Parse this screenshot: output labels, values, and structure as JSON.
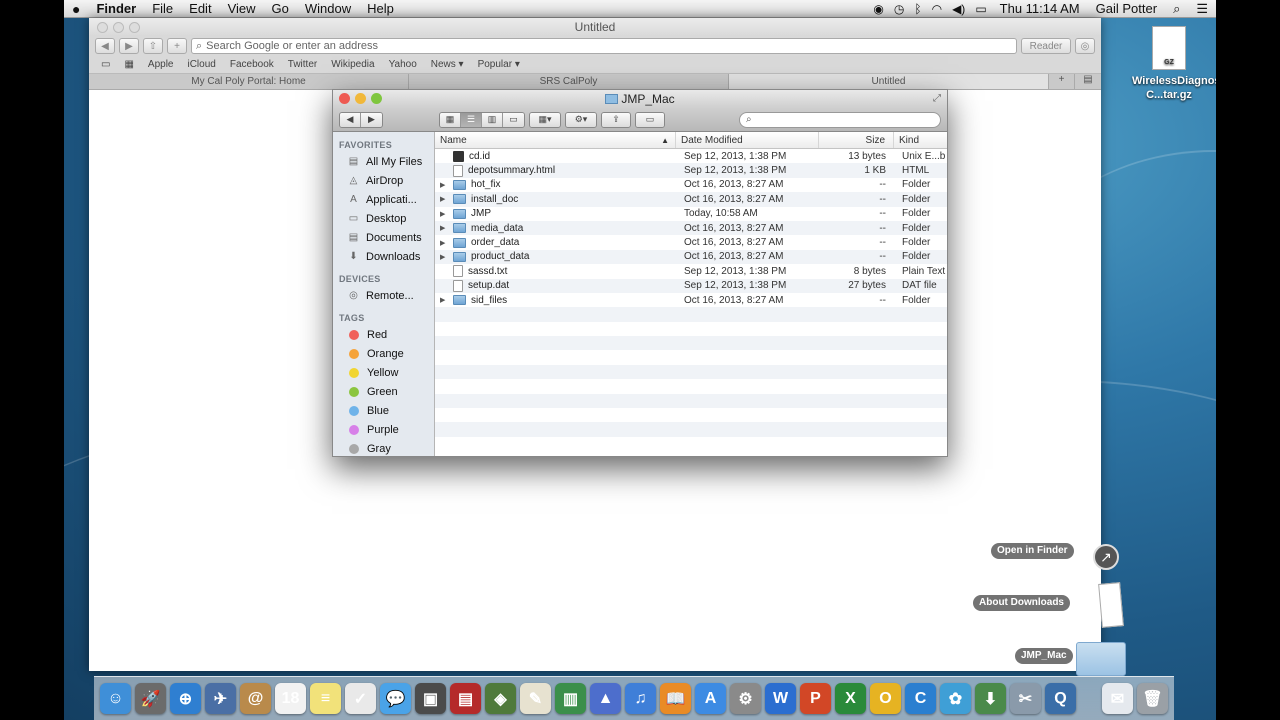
{
  "menubar": {
    "apple": "",
    "app_name": "Finder",
    "items": [
      "File",
      "Edit",
      "View",
      "Go",
      "Window",
      "Help"
    ],
    "clock": "Thu 11:14 AM",
    "user": "Gail Potter"
  },
  "safari": {
    "title": "Untitled",
    "address_placeholder": "Search Google or enter an address",
    "reader_label": "Reader",
    "bookmarks": [
      "Apple",
      "iCloud",
      "Facebook",
      "Twitter",
      "Wikipedia",
      "Yahoo",
      "News ▾",
      "Popular ▾"
    ],
    "tabs": [
      "My Cal Poly Portal: Home",
      "SRS CalPoly",
      "Untitled"
    ]
  },
  "finder": {
    "title": "JMP_Mac",
    "sidebar": {
      "favorites_label": "FAVORITES",
      "favorites": [
        "All My Files",
        "AirDrop",
        "Applicati...",
        "Desktop",
        "Documents",
        "Downloads"
      ],
      "devices_label": "DEVICES",
      "devices": [
        "Remote..."
      ],
      "tags_label": "TAGS",
      "tags": [
        {
          "name": "Red",
          "color": "#f0605a"
        },
        {
          "name": "Orange",
          "color": "#f5a33a"
        },
        {
          "name": "Yellow",
          "color": "#f1d531"
        },
        {
          "name": "Green",
          "color": "#8bc53f"
        },
        {
          "name": "Blue",
          "color": "#6fb3e9"
        },
        {
          "name": "Purple",
          "color": "#d780e8"
        },
        {
          "name": "Gray",
          "color": "#a8a8a8"
        }
      ]
    },
    "columns": {
      "name": "Name",
      "date": "Date Modified",
      "size": "Size",
      "kind": "Kind"
    },
    "files": [
      {
        "name": "cd.id",
        "date": "Sep 12, 2013, 1:38 PM",
        "size": "13 bytes",
        "kind": "Unix E...b",
        "type": "dark"
      },
      {
        "name": "depotsummary.html",
        "date": "Sep 12, 2013, 1:38 PM",
        "size": "1 KB",
        "kind": "HTML",
        "type": "doc"
      },
      {
        "name": "hot_fix",
        "date": "Oct 16, 2013, 8:27 AM",
        "size": "--",
        "kind": "Folder",
        "type": "folder"
      },
      {
        "name": "install_doc",
        "date": "Oct 16, 2013, 8:27 AM",
        "size": "--",
        "kind": "Folder",
        "type": "folder"
      },
      {
        "name": "JMP",
        "date": "Today, 10:58 AM",
        "size": "--",
        "kind": "Folder",
        "type": "folder"
      },
      {
        "name": "media_data",
        "date": "Oct 16, 2013, 8:27 AM",
        "size": "--",
        "kind": "Folder",
        "type": "folder"
      },
      {
        "name": "order_data",
        "date": "Oct 16, 2013, 8:27 AM",
        "size": "--",
        "kind": "Folder",
        "type": "folder"
      },
      {
        "name": "product_data",
        "date": "Oct 16, 2013, 8:27 AM",
        "size": "--",
        "kind": "Folder",
        "type": "folder"
      },
      {
        "name": "sassd.txt",
        "date": "Sep 12, 2013, 1:38 PM",
        "size": "8 bytes",
        "kind": "Plain Text",
        "type": "doc"
      },
      {
        "name": "setup.dat",
        "date": "Sep 12, 2013, 1:38 PM",
        "size": "27 bytes",
        "kind": "DAT file",
        "type": "doc"
      },
      {
        "name": "sid_files",
        "date": "Oct 16, 2013, 8:27 AM",
        "size": "--",
        "kind": "Folder",
        "type": "folder"
      }
    ]
  },
  "desktop": {
    "file_label": "WirelessDiagnostics-C...tar.gz",
    "file_badge": "GZ"
  },
  "stack": {
    "open_in_finder": "Open in Finder",
    "about_downloads": "About Downloads",
    "folder": "JMP_Mac"
  },
  "dock": [
    {
      "name": "finder",
      "color": "#3f8fd8",
      "glyph": "☺"
    },
    {
      "name": "launchpad",
      "color": "#6b6b6b",
      "glyph": "🚀"
    },
    {
      "name": "safari",
      "color": "#2f7fd1",
      "glyph": "⊕"
    },
    {
      "name": "preview",
      "color": "#4a6fa5",
      "glyph": "✈"
    },
    {
      "name": "contacts",
      "color": "#b98a4b",
      "glyph": "@"
    },
    {
      "name": "calendar",
      "color": "#f2f2f2",
      "glyph": "18"
    },
    {
      "name": "notes",
      "color": "#f2e27a",
      "glyph": "≡"
    },
    {
      "name": "reminders",
      "color": "#e9e9e9",
      "glyph": "✓"
    },
    {
      "name": "messages",
      "color": "#4aa3e8",
      "glyph": "💬"
    },
    {
      "name": "facetime",
      "color": "#4b4b4b",
      "glyph": "▣"
    },
    {
      "name": "photo-booth",
      "color": "#b52a2a",
      "glyph": "▤"
    },
    {
      "name": "iphoto",
      "color": "#4f7a3b",
      "glyph": "◈"
    },
    {
      "name": "textedit",
      "color": "#e7e2d0",
      "glyph": "✎"
    },
    {
      "name": "numbers",
      "color": "#3b8f4b",
      "glyph": "▥"
    },
    {
      "name": "keynote",
      "color": "#4d6ecc",
      "glyph": "▲"
    },
    {
      "name": "itunes",
      "color": "#3f7fd8",
      "glyph": "♫"
    },
    {
      "name": "ibooks",
      "color": "#e98b26",
      "glyph": "📖"
    },
    {
      "name": "app-store",
      "color": "#3d8be3",
      "glyph": "A"
    },
    {
      "name": "system-preferences",
      "color": "#8a8a8a",
      "glyph": "⚙"
    },
    {
      "name": "word",
      "color": "#2b6ed0",
      "glyph": "W"
    },
    {
      "name": "powerpoint",
      "color": "#d24726",
      "glyph": "P"
    },
    {
      "name": "excel",
      "color": "#2a8a3a",
      "glyph": "X"
    },
    {
      "name": "outlook",
      "color": "#e6b322",
      "glyph": "O"
    },
    {
      "name": "lync",
      "color": "#2a7fd0",
      "glyph": "C"
    },
    {
      "name": "messenger",
      "color": "#3f9fd6",
      "glyph": "✿"
    },
    {
      "name": "downloader",
      "color": "#4a8a4a",
      "glyph": "⬇"
    },
    {
      "name": "utility",
      "color": "#8a9aaa",
      "glyph": "✂"
    },
    {
      "name": "quicktime",
      "color": "#3a6ea8",
      "glyph": "Q"
    },
    {
      "name": "documents-stack",
      "color": "#e5e9ee",
      "glyph": "✉"
    },
    {
      "name": "trash",
      "color": "#9aa0a6",
      "glyph": "🗑"
    }
  ]
}
